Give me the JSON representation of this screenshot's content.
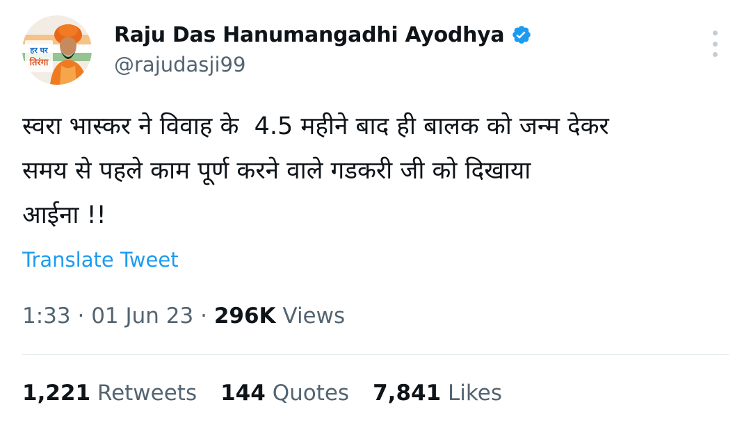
{
  "author": {
    "display_name": "Raju Das Hanumangadhi Ayodhya",
    "handle": "@rajudasji99",
    "verified": true,
    "avatar": {
      "icon": "profile-photo-avatar",
      "banner_text_1": "हर घर",
      "banner_text_2": "तिरंगा"
    }
  },
  "tweet": {
    "text": "स्वरा भास्कर ने विवाह के  4.5 महीने बाद ही बालक को जन्म देकर\nसमय से पहले काम पूर्ण करने वाले गडकरी जी को दिखाया\nआईना !!",
    "translate_label": "Translate Tweet"
  },
  "meta": {
    "time": "1:33",
    "separator": "·",
    "date": "01 Jun 23",
    "views_count": "296K",
    "views_label": "Views"
  },
  "stats": {
    "retweets_count": "1,221",
    "retweets_label": "Retweets",
    "quotes_count": "144",
    "quotes_label": "Quotes",
    "likes_count": "7,841",
    "likes_label": "Likes"
  },
  "colors": {
    "accent": "#1d9bf0",
    "text_primary": "#0f1419",
    "text_secondary": "#536471",
    "divider": "#e6ebee"
  }
}
